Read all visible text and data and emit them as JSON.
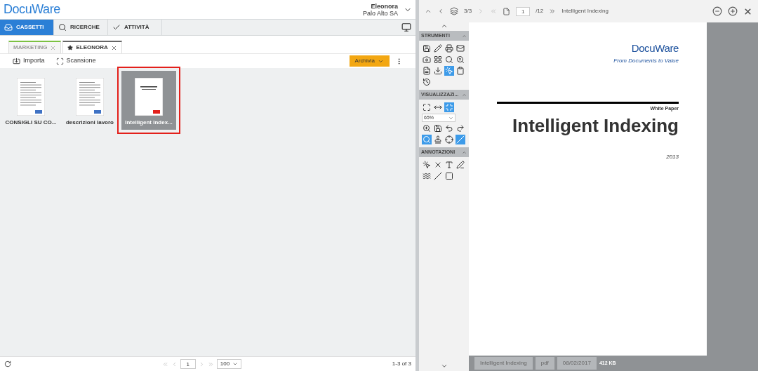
{
  "app": {
    "logo": "DocuWare",
    "user_name": "Eleonora",
    "user_org": "Palo Alto SA"
  },
  "nav_tabs": [
    {
      "label": "CASSETTI",
      "kind": "drawer",
      "selected": true
    },
    {
      "label": "RICERCHE",
      "kind": "search",
      "selected": false
    },
    {
      "label": "ATTIVITÀ",
      "kind": "check",
      "selected": false
    }
  ],
  "trays": [
    {
      "label": "MARKETING",
      "starred": false,
      "selected": false
    },
    {
      "label": "ELEONORA",
      "starred": true,
      "selected": true
    }
  ],
  "toolbar": {
    "import": "Importa",
    "scan": "Scansione",
    "archive": "Archivia"
  },
  "documents": [
    {
      "name": "CONSIGLI SU CO...",
      "kind": "word",
      "selected": false
    },
    {
      "name": "descrizioni lavoro",
      "kind": "word",
      "selected": false
    },
    {
      "name": "Intelligent Index...",
      "kind": "pdf",
      "selected": true
    }
  ],
  "pager": {
    "page": "1",
    "page_size": "100",
    "count": "1-3 of 3"
  },
  "viewer": {
    "stack": "3/3",
    "page": "1",
    "pages": "/12",
    "title": "Intelligent Indexing"
  },
  "sidebar": [
    {
      "title": "STRUMENTI",
      "tools": [
        {
          "kind": "save",
          "selected": false
        },
        {
          "kind": "pencil",
          "selected": false
        },
        {
          "kind": "print",
          "selected": false
        },
        {
          "kind": "mail",
          "selected": false
        },
        {
          "kind": "camera",
          "selected": false
        },
        {
          "kind": "grid",
          "selected": false
        },
        {
          "kind": "search",
          "selected": false
        },
        {
          "kind": "search-off",
          "selected": false
        },
        {
          "kind": "form",
          "selected": false
        },
        {
          "kind": "download",
          "selected": false
        },
        {
          "kind": "pointer",
          "selected": true
        },
        {
          "kind": "clipboard",
          "selected": false
        },
        {
          "kind": "history",
          "selected": false
        }
      ]
    },
    {
      "title": "VISUALIZZAZI...",
      "zoom": "65%",
      "tools": [
        {
          "kind": "fit-page",
          "selected": false
        },
        {
          "kind": "fit-width",
          "selected": false
        },
        {
          "kind": "fit-full",
          "selected": true
        },
        {
          "kind": "zoom-box",
          "selected": false
        },
        {
          "kind": "save",
          "selected": false
        },
        {
          "kind": "rotate-left",
          "selected": false
        },
        {
          "kind": "rotate-right",
          "selected": false
        },
        {
          "kind": "search",
          "selected": true
        },
        {
          "kind": "stamp",
          "selected": false
        },
        {
          "kind": "target",
          "selected": false
        },
        {
          "kind": "line",
          "selected": true
        }
      ]
    },
    {
      "title": "ANNOTAZIONI",
      "tools": [
        {
          "kind": "pointer",
          "selected": false
        },
        {
          "kind": "cross",
          "selected": false
        },
        {
          "kind": "text",
          "selected": false
        },
        {
          "kind": "pen",
          "selected": false
        },
        {
          "kind": "wave",
          "selected": false
        },
        {
          "kind": "line",
          "selected": false
        },
        {
          "kind": "square",
          "selected": false
        }
      ]
    }
  ],
  "page": {
    "logo": "DocuWare",
    "tagline": "From Documents to Value",
    "label": "White Paper",
    "heading": "Intelligent Indexing",
    "year": "2013"
  },
  "doc_footer": [
    "Intelligent Indexing",
    "pdf",
    "08/02/2017"
  ],
  "size": "412 KB"
}
